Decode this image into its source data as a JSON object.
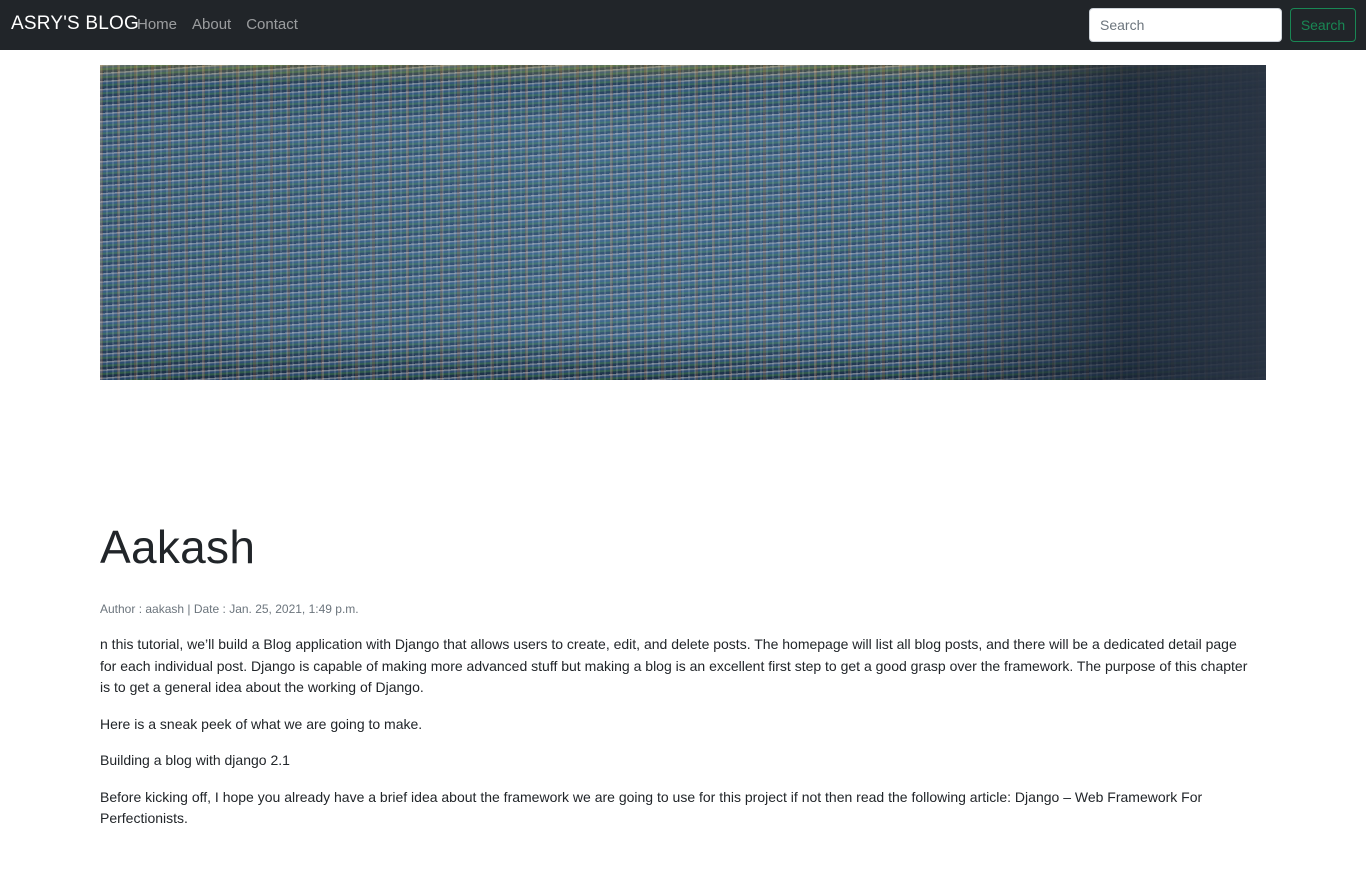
{
  "navbar": {
    "brand": "ASRY'S BLOG",
    "links": [
      "Home",
      "About",
      "Contact"
    ],
    "search_placeholder": "Search",
    "search_button": "Search",
    "colors": {
      "background": "#212529",
      "search_accent": "#198754"
    }
  },
  "hero": {
    "image": "blurred-code-screen-image"
  },
  "post": {
    "title": "Aakash",
    "meta": "Author : aakash | Date : Jan. 25, 2021, 1:49 p.m.",
    "paragraphs": [
      "n this tutorial, we’ll build a Blog application with Django that allows users to create, edit, and delete posts. The homepage will list all blog posts, and there will be a dedicated detail page for each individual post. Django is capable of making more advanced stuff but making a blog is an excellent first step to get a good grasp over the framework. The purpose of this chapter is to get a general idea about the working of Django.",
      "Here is a sneak peek of what we are going to make.",
      "Building a blog with django 2.1",
      "Before kicking off, I hope you already have a brief idea about the framework we are going to use for this project if not then read the following article: Django – Web Framework For Perfectionists."
    ]
  }
}
